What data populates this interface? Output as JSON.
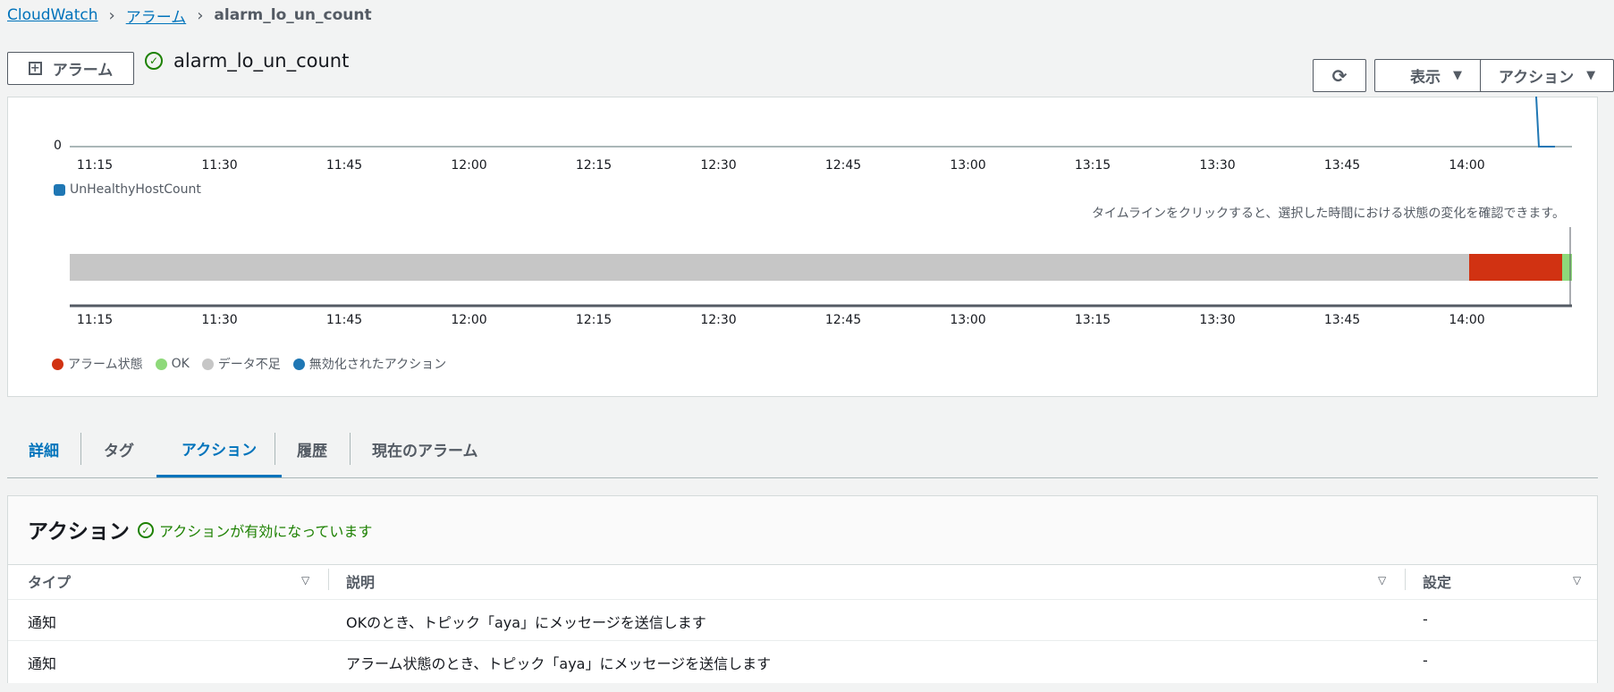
{
  "breadcrumb": {
    "root": "CloudWatch",
    "alarms": "アラーム",
    "current": "alarm_lo_un_count"
  },
  "header": {
    "add_alarm_label": "アラーム",
    "alarm_name": "alarm_lo_un_count",
    "view_label": "表示",
    "actions_label": "アクション"
  },
  "metric_chart": {
    "y_zero": "0",
    "legend": "UnHealthyHostCount",
    "x_ticks": [
      "11:15",
      "11:30",
      "11:45",
      "12:00",
      "12:15",
      "12:30",
      "12:45",
      "13:00",
      "13:15",
      "13:30",
      "13:45",
      "14:00"
    ]
  },
  "timeline": {
    "hint": "タイムラインをクリックすると、選択した時間における状態の変化を確認できます。",
    "x_ticks": [
      "11:15",
      "11:30",
      "11:45",
      "12:00",
      "12:15",
      "12:30",
      "12:45",
      "13:00",
      "13:15",
      "13:30",
      "13:45",
      "14:00"
    ],
    "legend": {
      "alarm": "アラーム状態",
      "ok": "OK",
      "insufficient": "データ不足",
      "disabled": "無効化されたアクション"
    }
  },
  "tabs": [
    "詳細",
    "タグ",
    "アクション",
    "履歴",
    "現在のアラーム"
  ],
  "actions_panel": {
    "title": "アクション",
    "status": "アクションが有効になっています",
    "columns": [
      "タイプ",
      "説明",
      "設定"
    ],
    "rows": [
      {
        "type": "通知",
        "desc": "OKのとき、トピック「aya」にメッセージを送信します",
        "config": "-"
      },
      {
        "type": "通知",
        "desc": "アラーム状態のとき、トピック「aya」にメッセージを送信します",
        "config": "-"
      }
    ]
  },
  "colors": {
    "link": "#0073bb",
    "alarm": "#d13212",
    "ok": "#8ed97a",
    "insufficient": "#c6c6c6",
    "disabled": "#1f77b4",
    "success": "#1d8102"
  }
}
